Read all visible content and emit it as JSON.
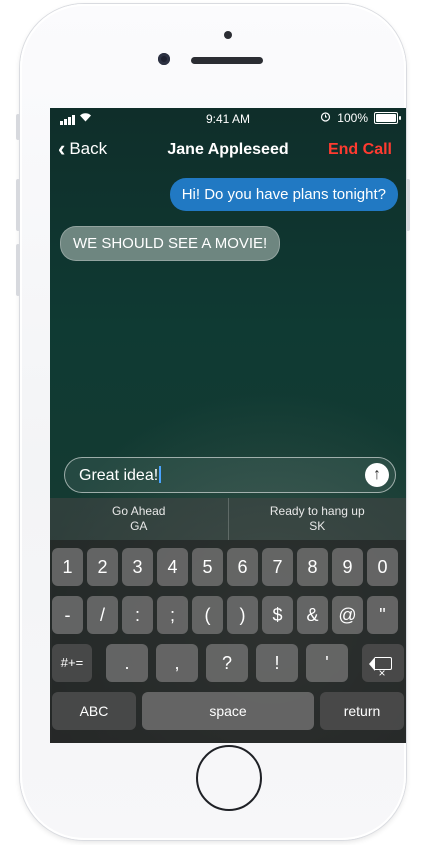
{
  "status": {
    "time": "9:41 AM",
    "battery": "100%"
  },
  "nav": {
    "back_label": "Back",
    "title": "Jane Appleseed",
    "end_call_label": "End Call"
  },
  "messages": [
    {
      "text": "Hi! Do you have plans tonight?",
      "direction": "outgoing"
    },
    {
      "text": "WE SHOULD SEE A MOVIE!",
      "direction": "incoming"
    }
  ],
  "compose": {
    "value": "Great idea!"
  },
  "suggestions": [
    {
      "label": "Go Ahead",
      "abbr": "GA"
    },
    {
      "label": "Ready to hang up",
      "abbr": "SK"
    }
  ],
  "keyboard": {
    "row1": [
      "1",
      "2",
      "3",
      "4",
      "5",
      "6",
      "7",
      "8",
      "9",
      "0"
    ],
    "row2": [
      "-",
      "/",
      ":",
      ";",
      "(",
      ")",
      "$",
      "&",
      "@",
      "\""
    ],
    "row3": [
      ".",
      ",",
      "?",
      "!",
      "'"
    ],
    "mode_key": "#+=",
    "abc_key": "ABC",
    "space_key": "space",
    "return_key": "return"
  },
  "colors": {
    "accent": "#2179c3",
    "end_call": "#ff3b30"
  }
}
